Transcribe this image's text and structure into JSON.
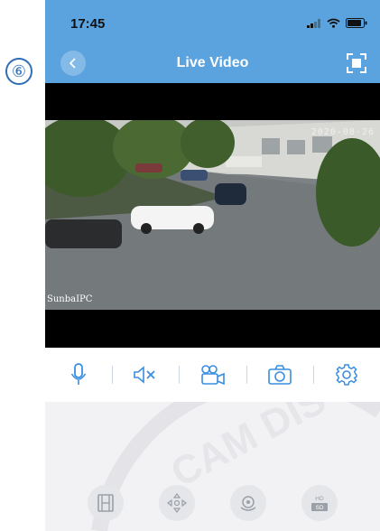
{
  "step_badge": "⑥",
  "status_bar": {
    "time": "17:45"
  },
  "nav": {
    "title": "Live Video"
  },
  "video": {
    "timestamp_overlay": "2020-08-26",
    "camera_name_overlay": "SunbaIPC"
  },
  "controls": [
    {
      "name": "microphone",
      "icon": "microphone-icon"
    },
    {
      "name": "mute",
      "icon": "speaker-mute-icon"
    },
    {
      "name": "record",
      "icon": "video-record-icon"
    },
    {
      "name": "snapshot",
      "icon": "camera-icon"
    },
    {
      "name": "settings",
      "icon": "gear-icon"
    }
  ],
  "functions": [
    {
      "name": "playback",
      "icon": "film-icon"
    },
    {
      "name": "ptz",
      "icon": "ptz-directions-icon"
    },
    {
      "name": "preset",
      "icon": "preset-icon"
    },
    {
      "name": "quality",
      "icon": "hd-sd-icon",
      "hd_label": "HD",
      "sd_label": "SD"
    }
  ],
  "watermark_text": "CAM DIS",
  "colors": {
    "header": "#5ba3df",
    "accent": "#3a8ee0",
    "background": "#f2f2f4"
  }
}
